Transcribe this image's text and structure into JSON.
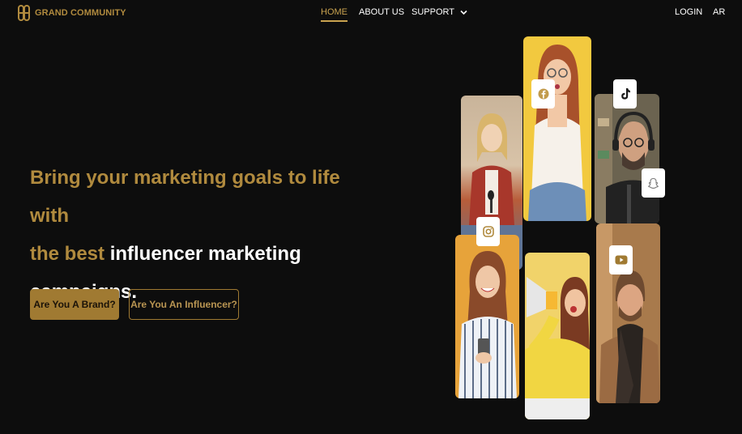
{
  "brand": {
    "name": "GRAND COMMUNITY"
  },
  "nav": {
    "items": [
      {
        "label": "HOME"
      },
      {
        "label": "ABOUT US"
      },
      {
        "label": "SUPPORT"
      }
    ],
    "login": "LOGIN",
    "language": "AR"
  },
  "hero": {
    "line1": "Bring your marketing goals to life with",
    "line2_gold": "the best",
    "line2_white": "influencer marketing",
    "line3": "campaigns."
  },
  "buttons": {
    "brand": "Are You A Brand?",
    "influencer": "Are You An Influencer?"
  },
  "colors": {
    "accent": "#b08a3e",
    "background": "#0d0d0d"
  },
  "social_icons": [
    "facebook-icon",
    "tiktok-icon",
    "snapchat-icon",
    "instagram-icon",
    "youtube-icon"
  ]
}
